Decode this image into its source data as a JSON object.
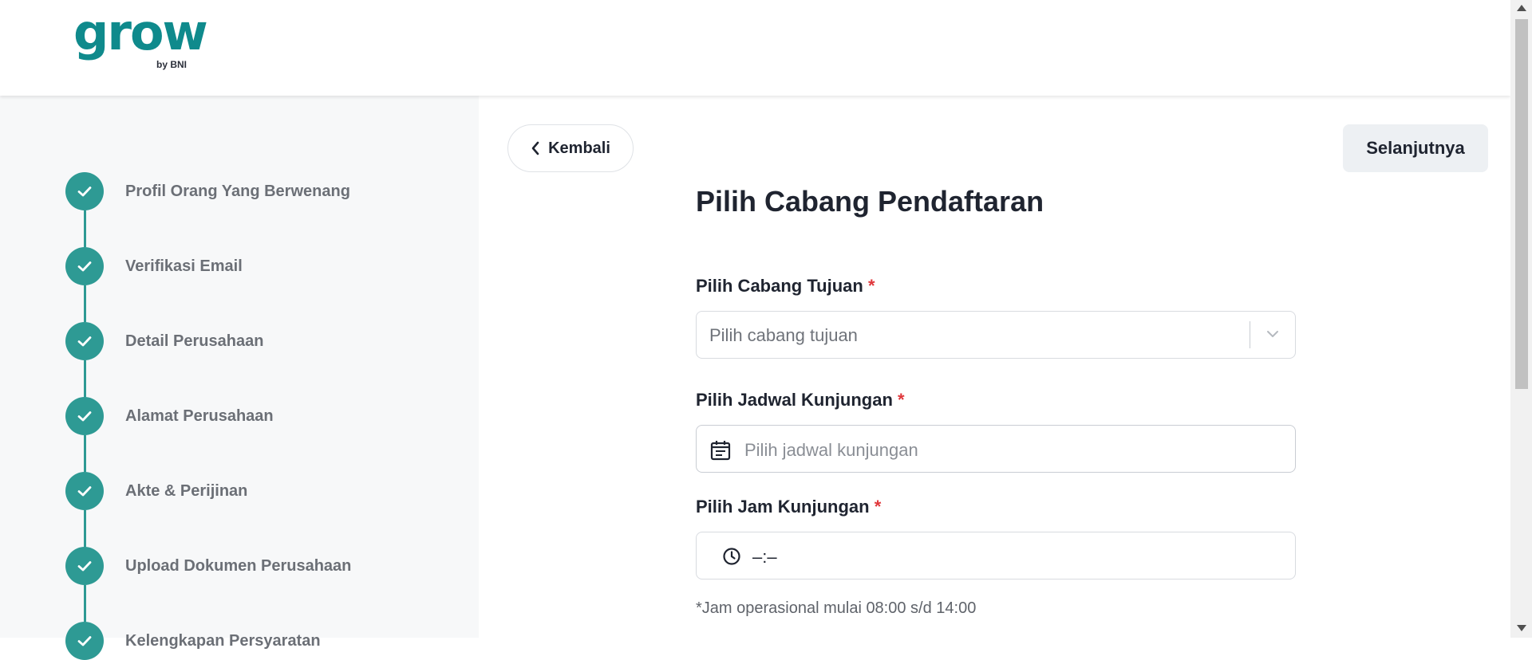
{
  "brand": {
    "logo_word": "grow",
    "logo_sub": "by BNI"
  },
  "steps": [
    {
      "label": "Profil Orang Yang Berwenang",
      "status": "done"
    },
    {
      "label": "Verifikasi Email",
      "status": "done"
    },
    {
      "label": "Detail Perusahaan",
      "status": "done"
    },
    {
      "label": "Alamat Perusahaan",
      "status": "done"
    },
    {
      "label": "Akte & Perijinan",
      "status": "done"
    },
    {
      "label": "Upload Dokumen Perusahaan",
      "status": "done"
    },
    {
      "label": "Kelengkapan Persyaratan",
      "status": "done"
    }
  ],
  "actions": {
    "back_label": "Kembali",
    "next_label": "Selanjutnya"
  },
  "form": {
    "title": "Pilih Cabang Pendaftaran",
    "branch": {
      "label": "Pilih Cabang Tujuan",
      "required_mark": "*",
      "placeholder": "Pilih cabang tujuan"
    },
    "date": {
      "label": "Pilih Jadwal Kunjungan",
      "required_mark": "*",
      "placeholder": "Pilih jadwal kunjungan"
    },
    "time": {
      "label": "Pilih Jam Kunjungan",
      "required_mark": "*",
      "value": "–:–"
    },
    "hint": "*Jam operasional mulai 08:00 s/d 14:00"
  },
  "colors": {
    "accent": "#2e9a94",
    "brand": "#0f8a8c",
    "required": "#e0373b"
  }
}
